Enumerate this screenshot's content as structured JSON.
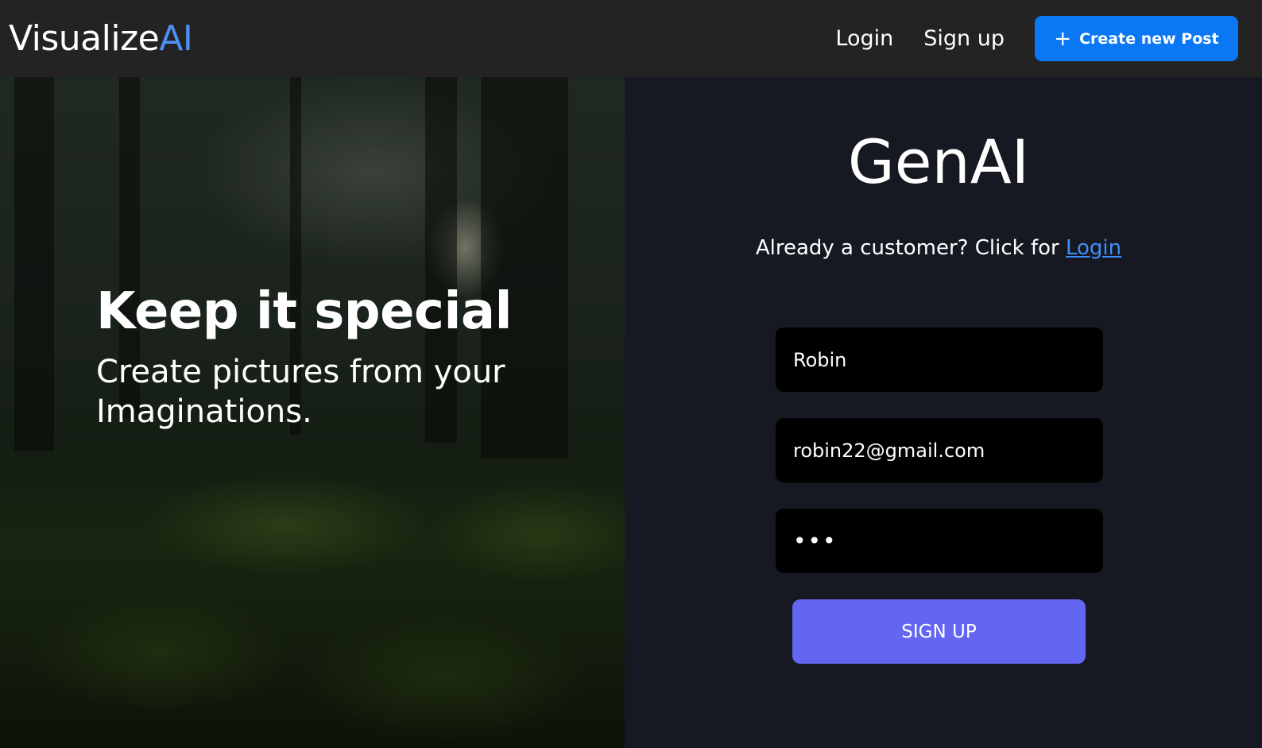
{
  "navbar": {
    "logo_main": "Visualize",
    "logo_accent": "AI",
    "login_label": "Login",
    "signup_label": "Sign up",
    "create_button_label": "Create new Post"
  },
  "hero": {
    "title": "Keep it special",
    "subtitle": "Create pictures from your Imaginations."
  },
  "form": {
    "title": "GenAI",
    "already_text": "Already a customer? Click for ",
    "login_link": "Login",
    "name_value": "Robin",
    "email_value": "robin22@gmail.com",
    "password_masked": "•••",
    "submit_label": "SIGN UP"
  },
  "colors": {
    "navbar_bg": "#232323",
    "panel_bg": "#161922",
    "accent_blue": "#0a78f5",
    "logo_accent": "#4f8ff3",
    "link_blue": "#3e8ef7",
    "submit_bg": "#6366f0"
  }
}
